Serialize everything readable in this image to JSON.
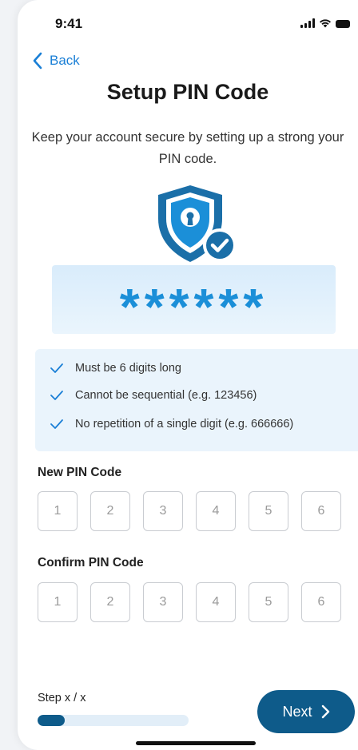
{
  "status_bar": {
    "time": "9:41"
  },
  "nav": {
    "back_label": "Back"
  },
  "header": {
    "title": "Setup PIN Code",
    "subtitle": "Keep your account secure by setting up a strong your PIN code."
  },
  "pin_display": {
    "masked": "******"
  },
  "rules": [
    "Must be 6 digits long",
    "Cannot be sequential (e.g. 123456)",
    "No repetition of a single digit (e.g. 666666)"
  ],
  "new_pin": {
    "label": "New PIN Code",
    "placeholders": [
      "1",
      "2",
      "3",
      "4",
      "5",
      "6"
    ]
  },
  "confirm_pin": {
    "label": "Confirm PIN Code",
    "placeholders": [
      "1",
      "2",
      "3",
      "4",
      "5",
      "6"
    ]
  },
  "footer": {
    "step_label": "Step x / x",
    "progress": 0.18,
    "next_label": "Next"
  },
  "colors": {
    "primary": "#0e5b8a",
    "accent": "#1b8fd8",
    "link": "#1a7fd6",
    "panel": "#eaf4fc"
  }
}
